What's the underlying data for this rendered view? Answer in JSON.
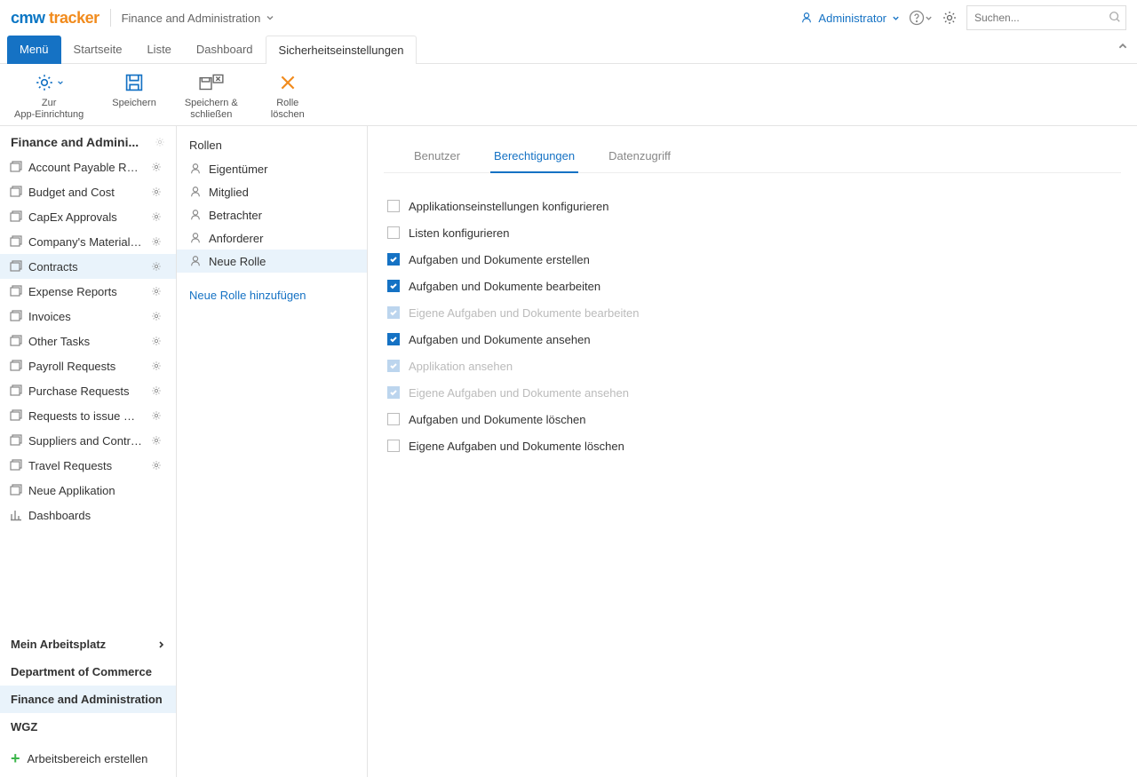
{
  "header": {
    "logo_cmw": "cmw",
    "logo_tracker": "tracker",
    "breadcrumb": "Finance and Administration",
    "user": "Administrator",
    "search_placeholder": "Suchen..."
  },
  "nav": {
    "menu": "Menü",
    "items": [
      "Startseite",
      "Liste",
      "Dashboard",
      "Sicherheitseinstellungen"
    ],
    "active_index": 3
  },
  "toolbar": {
    "items": [
      {
        "label": "Zur\nApp-Einrichtung",
        "icon": "gear"
      },
      {
        "label": "Speichern",
        "icon": "save"
      },
      {
        "label": "Speichern &\nschließen",
        "icon": "save-close"
      },
      {
        "label": "Rolle\nlöschen",
        "icon": "delete"
      }
    ]
  },
  "sidebar": {
    "title": "Finance and Admini...",
    "items": [
      "Account Payable Requ...",
      "Budget and Cost",
      "CapEx Approvals",
      "Company's Material A...",
      "Contracts",
      "Expense Reports",
      "Invoices",
      "Other Tasks",
      "Payroll Requests",
      "Purchase Requests",
      "Requests to issue Mat...",
      "Suppliers and Contrac...",
      "Travel Requests"
    ],
    "selected_index": 4,
    "neue_app": "Neue Applikation",
    "dashboards": "Dashboards",
    "workspaces": [
      {
        "label": "Mein Arbeitsplatz",
        "chevron": true
      },
      {
        "label": "Department of Commerce"
      },
      {
        "label": "Finance and Administration",
        "active": true
      },
      {
        "label": "WGZ"
      }
    ],
    "create_ws": "Arbeitsbereich erstellen"
  },
  "roles": {
    "header": "Rollen",
    "items": [
      "Eigentümer",
      "Mitglied",
      "Betrachter",
      "Anforderer",
      "Neue Rolle"
    ],
    "selected_index": 4,
    "add_link": "Neue Rolle hinzufügen"
  },
  "content": {
    "tabs": [
      "Benutzer",
      "Berechtigungen",
      "Datenzugriff"
    ],
    "active_tab": 1,
    "permissions": [
      {
        "label": "Applikationseinstellungen konfigurieren",
        "checked": false
      },
      {
        "label": "Listen konfigurieren",
        "checked": false
      },
      {
        "label": "Aufgaben und Dokumente erstellen",
        "checked": true
      },
      {
        "label": "Aufgaben und Dokumente bearbeiten",
        "checked": true
      },
      {
        "label": "Eigene Aufgaben und Dokumente bearbeiten",
        "checked": true,
        "disabled": true
      },
      {
        "label": "Aufgaben und Dokumente ansehen",
        "checked": true
      },
      {
        "label": "Applikation ansehen",
        "checked": true,
        "disabled": true
      },
      {
        "label": "Eigene Aufgaben und Dokumente ansehen",
        "checked": true,
        "disabled": true
      },
      {
        "label": "Aufgaben und Dokumente löschen",
        "checked": false
      },
      {
        "label": "Eigene Aufgaben und Dokumente löschen",
        "checked": false
      }
    ]
  }
}
